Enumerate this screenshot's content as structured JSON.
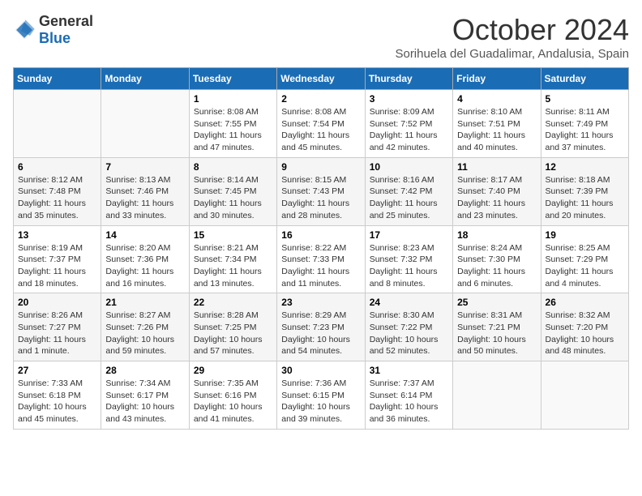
{
  "header": {
    "logo_general": "General",
    "logo_blue": "Blue",
    "month_title": "October 2024",
    "subtitle": "Sorihuela del Guadalimar, Andalusia, Spain"
  },
  "weekdays": [
    "Sunday",
    "Monday",
    "Tuesday",
    "Wednesday",
    "Thursday",
    "Friday",
    "Saturday"
  ],
  "weeks": [
    [
      {
        "day": "",
        "sunrise": "",
        "sunset": "",
        "daylight": ""
      },
      {
        "day": "",
        "sunrise": "",
        "sunset": "",
        "daylight": ""
      },
      {
        "day": "1",
        "sunrise": "Sunrise: 8:08 AM",
        "sunset": "Sunset: 7:55 PM",
        "daylight": "Daylight: 11 hours and 47 minutes."
      },
      {
        "day": "2",
        "sunrise": "Sunrise: 8:08 AM",
        "sunset": "Sunset: 7:54 PM",
        "daylight": "Daylight: 11 hours and 45 minutes."
      },
      {
        "day": "3",
        "sunrise": "Sunrise: 8:09 AM",
        "sunset": "Sunset: 7:52 PM",
        "daylight": "Daylight: 11 hours and 42 minutes."
      },
      {
        "day": "4",
        "sunrise": "Sunrise: 8:10 AM",
        "sunset": "Sunset: 7:51 PM",
        "daylight": "Daylight: 11 hours and 40 minutes."
      },
      {
        "day": "5",
        "sunrise": "Sunrise: 8:11 AM",
        "sunset": "Sunset: 7:49 PM",
        "daylight": "Daylight: 11 hours and 37 minutes."
      }
    ],
    [
      {
        "day": "6",
        "sunrise": "Sunrise: 8:12 AM",
        "sunset": "Sunset: 7:48 PM",
        "daylight": "Daylight: 11 hours and 35 minutes."
      },
      {
        "day": "7",
        "sunrise": "Sunrise: 8:13 AM",
        "sunset": "Sunset: 7:46 PM",
        "daylight": "Daylight: 11 hours and 33 minutes."
      },
      {
        "day": "8",
        "sunrise": "Sunrise: 8:14 AM",
        "sunset": "Sunset: 7:45 PM",
        "daylight": "Daylight: 11 hours and 30 minutes."
      },
      {
        "day": "9",
        "sunrise": "Sunrise: 8:15 AM",
        "sunset": "Sunset: 7:43 PM",
        "daylight": "Daylight: 11 hours and 28 minutes."
      },
      {
        "day": "10",
        "sunrise": "Sunrise: 8:16 AM",
        "sunset": "Sunset: 7:42 PM",
        "daylight": "Daylight: 11 hours and 25 minutes."
      },
      {
        "day": "11",
        "sunrise": "Sunrise: 8:17 AM",
        "sunset": "Sunset: 7:40 PM",
        "daylight": "Daylight: 11 hours and 23 minutes."
      },
      {
        "day": "12",
        "sunrise": "Sunrise: 8:18 AM",
        "sunset": "Sunset: 7:39 PM",
        "daylight": "Daylight: 11 hours and 20 minutes."
      }
    ],
    [
      {
        "day": "13",
        "sunrise": "Sunrise: 8:19 AM",
        "sunset": "Sunset: 7:37 PM",
        "daylight": "Daylight: 11 hours and 18 minutes."
      },
      {
        "day": "14",
        "sunrise": "Sunrise: 8:20 AM",
        "sunset": "Sunset: 7:36 PM",
        "daylight": "Daylight: 11 hours and 16 minutes."
      },
      {
        "day": "15",
        "sunrise": "Sunrise: 8:21 AM",
        "sunset": "Sunset: 7:34 PM",
        "daylight": "Daylight: 11 hours and 13 minutes."
      },
      {
        "day": "16",
        "sunrise": "Sunrise: 8:22 AM",
        "sunset": "Sunset: 7:33 PM",
        "daylight": "Daylight: 11 hours and 11 minutes."
      },
      {
        "day": "17",
        "sunrise": "Sunrise: 8:23 AM",
        "sunset": "Sunset: 7:32 PM",
        "daylight": "Daylight: 11 hours and 8 minutes."
      },
      {
        "day": "18",
        "sunrise": "Sunrise: 8:24 AM",
        "sunset": "Sunset: 7:30 PM",
        "daylight": "Daylight: 11 hours and 6 minutes."
      },
      {
        "day": "19",
        "sunrise": "Sunrise: 8:25 AM",
        "sunset": "Sunset: 7:29 PM",
        "daylight": "Daylight: 11 hours and 4 minutes."
      }
    ],
    [
      {
        "day": "20",
        "sunrise": "Sunrise: 8:26 AM",
        "sunset": "Sunset: 7:27 PM",
        "daylight": "Daylight: 11 hours and 1 minute."
      },
      {
        "day": "21",
        "sunrise": "Sunrise: 8:27 AM",
        "sunset": "Sunset: 7:26 PM",
        "daylight": "Daylight: 10 hours and 59 minutes."
      },
      {
        "day": "22",
        "sunrise": "Sunrise: 8:28 AM",
        "sunset": "Sunset: 7:25 PM",
        "daylight": "Daylight: 10 hours and 57 minutes."
      },
      {
        "day": "23",
        "sunrise": "Sunrise: 8:29 AM",
        "sunset": "Sunset: 7:23 PM",
        "daylight": "Daylight: 10 hours and 54 minutes."
      },
      {
        "day": "24",
        "sunrise": "Sunrise: 8:30 AM",
        "sunset": "Sunset: 7:22 PM",
        "daylight": "Daylight: 10 hours and 52 minutes."
      },
      {
        "day": "25",
        "sunrise": "Sunrise: 8:31 AM",
        "sunset": "Sunset: 7:21 PM",
        "daylight": "Daylight: 10 hours and 50 minutes."
      },
      {
        "day": "26",
        "sunrise": "Sunrise: 8:32 AM",
        "sunset": "Sunset: 7:20 PM",
        "daylight": "Daylight: 10 hours and 48 minutes."
      }
    ],
    [
      {
        "day": "27",
        "sunrise": "Sunrise: 7:33 AM",
        "sunset": "Sunset: 6:18 PM",
        "daylight": "Daylight: 10 hours and 45 minutes."
      },
      {
        "day": "28",
        "sunrise": "Sunrise: 7:34 AM",
        "sunset": "Sunset: 6:17 PM",
        "daylight": "Daylight: 10 hours and 43 minutes."
      },
      {
        "day": "29",
        "sunrise": "Sunrise: 7:35 AM",
        "sunset": "Sunset: 6:16 PM",
        "daylight": "Daylight: 10 hours and 41 minutes."
      },
      {
        "day": "30",
        "sunrise": "Sunrise: 7:36 AM",
        "sunset": "Sunset: 6:15 PM",
        "daylight": "Daylight: 10 hours and 39 minutes."
      },
      {
        "day": "31",
        "sunrise": "Sunrise: 7:37 AM",
        "sunset": "Sunset: 6:14 PM",
        "daylight": "Daylight: 10 hours and 36 minutes."
      },
      {
        "day": "",
        "sunrise": "",
        "sunset": "",
        "daylight": ""
      },
      {
        "day": "",
        "sunrise": "",
        "sunset": "",
        "daylight": ""
      }
    ]
  ]
}
